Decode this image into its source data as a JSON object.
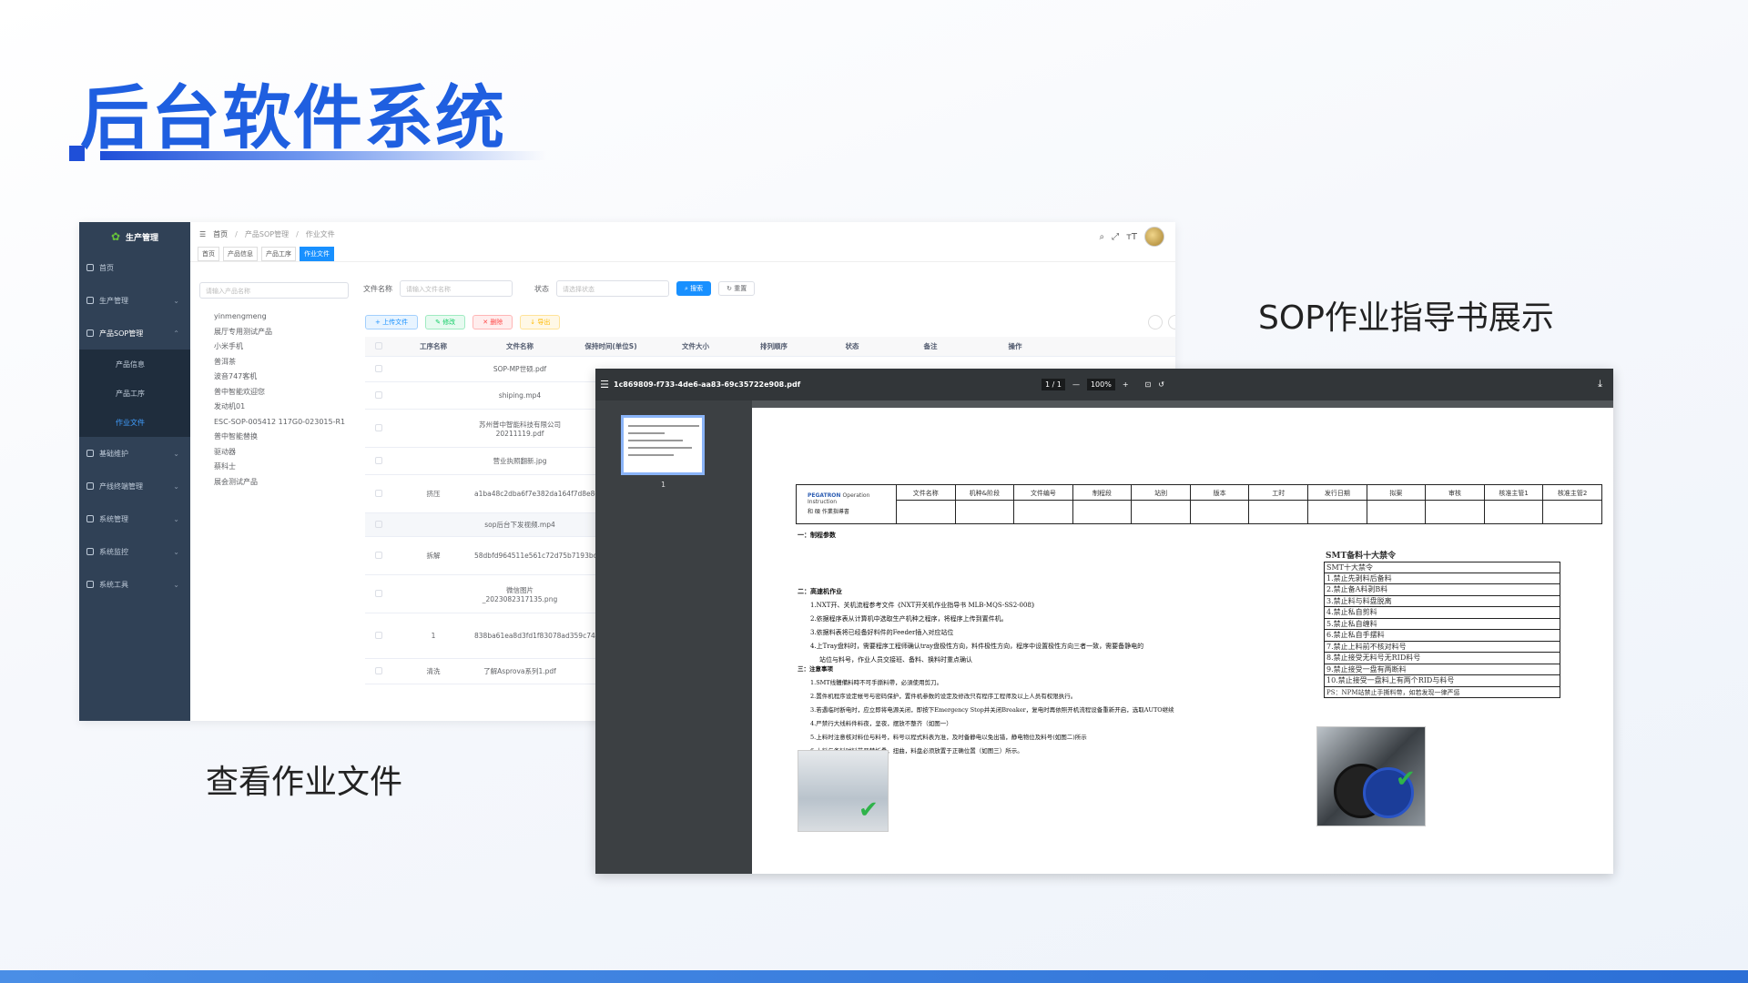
{
  "slide": {
    "title": "后台软件系统",
    "caption_left": "查看作业文件",
    "caption_right": "SOP作业指导书展示"
  },
  "admin": {
    "app_title": "生产管理",
    "sidebar": [
      {
        "label": "首页",
        "expandable": false
      },
      {
        "label": "生产管理",
        "expandable": true
      },
      {
        "label": "产品SOP管理",
        "expandable": true,
        "open": true,
        "children": [
          {
            "label": "产品信息"
          },
          {
            "label": "产品工序"
          },
          {
            "label": "作业文件",
            "active": true
          }
        ]
      },
      {
        "label": "基础维护",
        "expandable": true
      },
      {
        "label": "产线终端管理",
        "expandable": true
      },
      {
        "label": "系统管理",
        "expandable": true
      },
      {
        "label": "系统监控",
        "expandable": true
      },
      {
        "label": "系统工具",
        "expandable": true
      }
    ],
    "breadcrumb": [
      "首页",
      "产品SOP管理",
      "作业文件"
    ],
    "tabs": [
      "首页",
      "产品信息",
      "产品工序",
      "作业文件"
    ],
    "tree_search_placeholder": "请输入产品名称",
    "tree_items": [
      "yinmengmeng",
      "展厅专用测试产品",
      "小米手机",
      "普洱茶",
      "波音747客机",
      "普中智能欢迎您",
      "发动机01",
      "ESC-SOP-005412 117G0-023015-R1",
      "普中智能替换",
      "驱动器",
      "蔡科士",
      "展会测试产品"
    ],
    "filter": {
      "name_label": "文件名称",
      "name_placeholder": "请输入文件名称",
      "status_label": "状态",
      "status_placeholder": "请选择状态",
      "search": "搜索",
      "reset": "重置"
    },
    "toolbar": {
      "upload": "上传文件",
      "edit": "修改",
      "delete": "删除",
      "export": "导出"
    },
    "columns": [
      "工序名称",
      "文件名称",
      "保持时间(单位S)",
      "文件大小",
      "排列顺序",
      "状态",
      "备注",
      "操作"
    ],
    "rows": [
      {
        "process": "",
        "file": "SOP-MP世硕.pdf"
      },
      {
        "process": "",
        "file": "shiping.mp4"
      },
      {
        "process": "",
        "file": "苏州普中智能科技有限公司20211119.pdf"
      },
      {
        "process": "",
        "file": "营业执照翻新.jpg"
      },
      {
        "process": "挤压",
        "file": "a1ba48c2dba6f7e382da164f7d8e8e54_.png"
      },
      {
        "process": "",
        "file": "sop后台下发视频.mp4"
      },
      {
        "process": "拆解",
        "file": "58dbfd964511e561c72d75b7193bdd.jpg"
      },
      {
        "process": "",
        "file": "微信图片_2023082317135.png"
      },
      {
        "process": "1",
        "file": "838ba61ea8d3fd1f83078ad359c74e1994ca5f58.jpeg"
      },
      {
        "process": "清洗",
        "file": "了解Asprova系列1.pdf"
      }
    ]
  },
  "pdf": {
    "filename": "1c869809-f733-4de6-aa83-69c35722e908.pdf",
    "page_current": "1",
    "page_total": "1",
    "zoom": "100%",
    "thumb_label": "1",
    "doc": {
      "logo_brand": "PEGATRON",
      "logo_sub": "Operation Instruction",
      "logo_cn": "和 碩  作業指導書",
      "header_cols": [
        "文件名称",
        "机种&阶段",
        "文件编号",
        "制程段",
        "站别",
        "版本",
        "工时",
        "发行日期",
        "拟案",
        "审核",
        "核准主管1",
        "核准主管2"
      ],
      "sec1_title": "一：制程参数",
      "sec2_title": "二：高速机作业",
      "sec2_lines": [
        "1.NXT开、关机流程参考文件《NXT开关机作业指导书  MLB-MQS-SS2-008》",
        "2.依据程序表从计算机中选取生产机种之程序，将程序上传到置件机。",
        "3.依据料表将已经备好料件的Feeder插入对应站位",
        "4.上Tray盘料时，需要程序工程师确认tray盘极性方向，料件极性方向，程序中设置极性方向三者一致，需要备静电的",
        "站位与料号，作业人员交接班、备料、换料时重点确认"
      ],
      "sec3_title": "三：注意事项",
      "sec3_lines": [
        "1.SMT线體備料時不可手撕料帶，必須使用剪刀。",
        "2.置件机程序设定帐号与密码保护，置件机参数的设定及修改只有程序工程师及以上人员有权限执行。",
        "3.若遇临时断电时，应立即将电源关闭，即按下Emergency Stop并关闭Breaker，复电时再依照开机流程设备重新开启，选取AUTO继续",
        "4.严禁行大线料件料夜，坚夜，摆放不整齐（如图一）",
        "5.上料时注意核对料位与料号，料号以程式料表为准，及时备静电以免出错，静电物位及料号(如图二)所示",
        "6.上料与备料时料带严禁折叠，扭曲，料盘必须放置于正确位置（如图三）所示。"
      ],
      "smt_title": "SMT备料十大禁令",
      "smt_rows": [
        "SMT十大禁令",
        "1.禁止先剥料后备料",
        "2.禁止备A料剥B料",
        "3.禁止料与料盘脱离",
        "4.禁止私自剪料",
        "5.禁止私自缠料",
        "6.禁止私自手摆料",
        "7.禁止上料前不核对料号",
        "8.禁止接受无料号无RID料号",
        "9.禁止接受一盘有两断料",
        "10.禁止接受一盘料上有两个RID与料号",
        "PS：NPM站禁止手撕料带，如若发现一律严惩"
      ]
    }
  },
  "colors": {
    "title_blue": "#1f5fe0",
    "sidebar_bg": "#304156",
    "primary": "#1890ff",
    "pdf_toolbar": "#323639"
  },
  "icons": [
    "menu-fold-icon",
    "search-icon",
    "fullscreen-icon",
    "font-size-icon",
    "avatar",
    "home-icon",
    "cart-icon",
    "sop-icon",
    "tools-icon",
    "terminal-icon",
    "gear-icon",
    "monitor-icon",
    "toolbox-icon",
    "chevron-down-icon",
    "upload-icon",
    "edit-icon",
    "delete-icon",
    "export-icon",
    "refresh-icon",
    "download-icon",
    "rotate-icon",
    "fit-page-icon",
    "check-icon"
  ]
}
